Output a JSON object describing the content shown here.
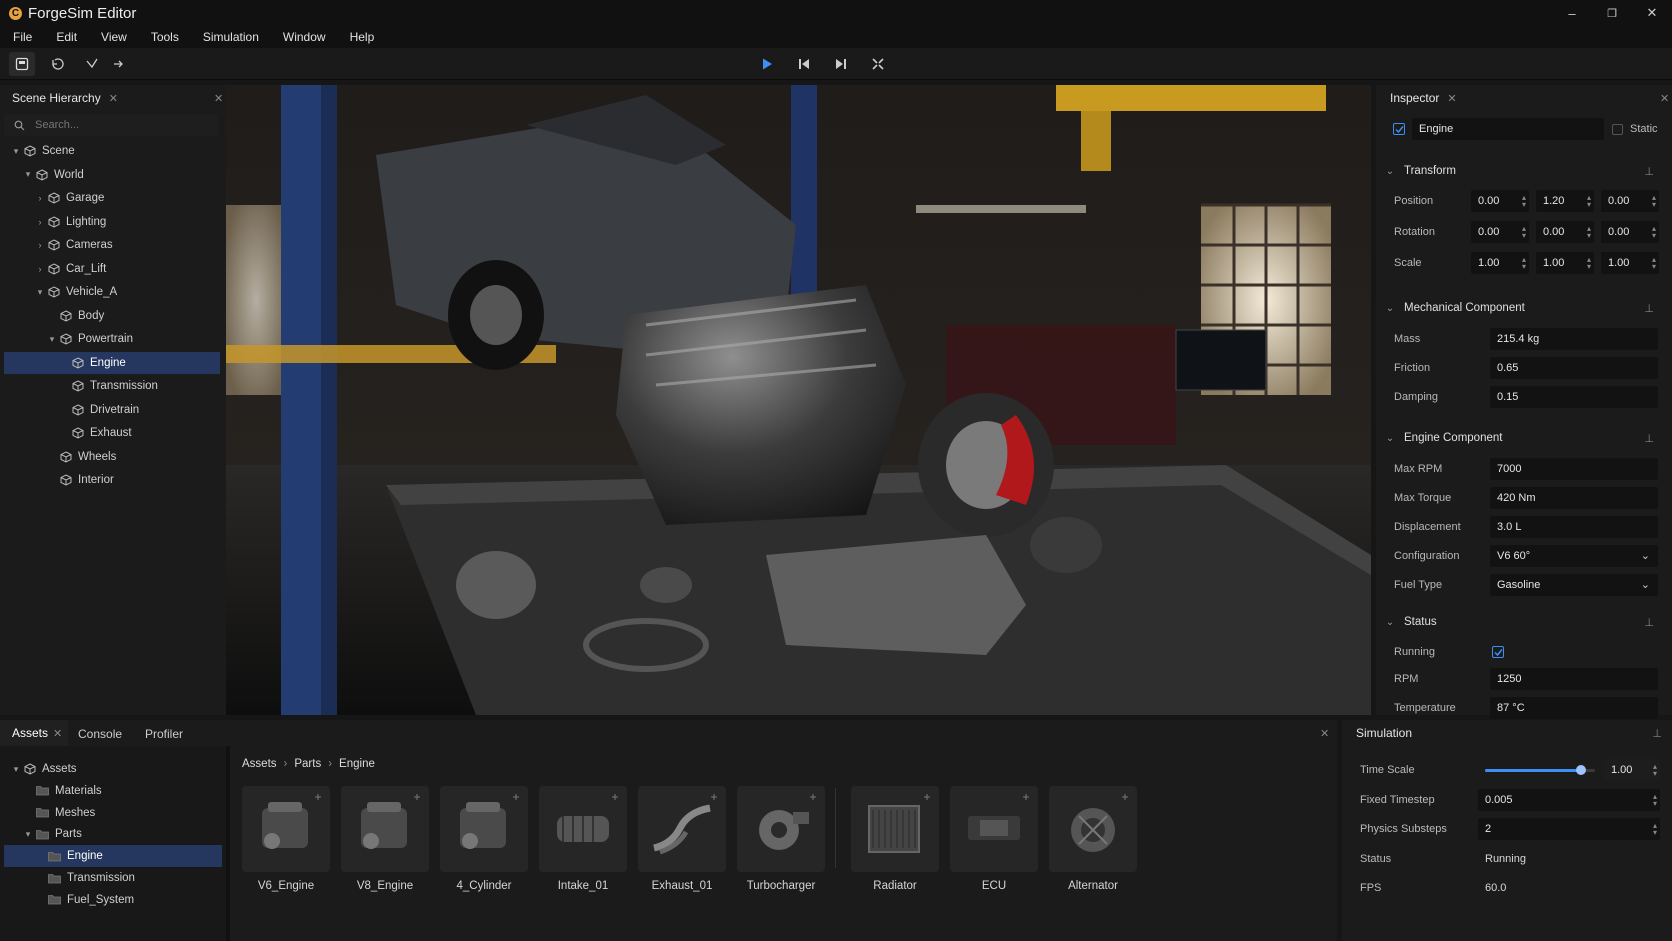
{
  "app": {
    "title": "ForgeSim Editor"
  },
  "window_controls": {
    "minimize": "–",
    "maximize": "❐",
    "close": "✕"
  },
  "menu": [
    "File",
    "Edit",
    "View",
    "Tools",
    "Simulation",
    "Window",
    "Help"
  ],
  "toolbar": {
    "left_tools": [
      "save-icon",
      "undo-icon",
      "select-icon",
      "move-icon"
    ],
    "playback": [
      "play-icon",
      "step-back-icon",
      "step-forward-icon",
      "maximize-icon"
    ],
    "accent": "#3d8ef5"
  },
  "hierarchy": {
    "title": "Scene Hierarchy",
    "search_placeholder": "Search...",
    "items": [
      {
        "label": "Scene",
        "depth": 0,
        "expanded": true
      },
      {
        "label": "World",
        "depth": 1,
        "expanded": true
      },
      {
        "label": "Garage",
        "depth": 2,
        "expanded": false
      },
      {
        "label": "Lighting",
        "depth": 2,
        "expanded": false
      },
      {
        "label": "Cameras",
        "depth": 2,
        "expanded": false
      },
      {
        "label": "Car_Lift",
        "depth": 2,
        "expanded": false
      },
      {
        "label": "Vehicle_A",
        "depth": 2,
        "expanded": true
      },
      {
        "label": "Body",
        "depth": 3
      },
      {
        "label": "Powertrain",
        "depth": 3,
        "expanded": true
      },
      {
        "label": "Engine",
        "depth": 4,
        "selected": true
      },
      {
        "label": "Transmission",
        "depth": 4
      },
      {
        "label": "Drivetrain",
        "depth": 4
      },
      {
        "label": "Exhaust",
        "depth": 4
      },
      {
        "label": "Wheels",
        "depth": 3
      },
      {
        "label": "Interior",
        "depth": 3
      }
    ]
  },
  "viewport": {
    "description_icon": "garage-scene-viewport"
  },
  "inspector": {
    "title": "Inspector",
    "object_name": "Engine",
    "static_label": "Static",
    "transform": {
      "title": "Transform",
      "rows": [
        {
          "label": "Position",
          "values": [
            "0.00",
            "1.20",
            "0.00"
          ]
        },
        {
          "label": "Rotation",
          "values": [
            "0.00",
            "0.00",
            "0.00"
          ]
        },
        {
          "label": "Scale",
          "values": [
            "1.00",
            "1.00",
            "1.00"
          ]
        }
      ]
    },
    "mechanical": {
      "title": "Mechanical Component",
      "rows": [
        {
          "label": "Mass",
          "value": "215.4 kg"
        },
        {
          "label": "Friction",
          "value": "0.65"
        },
        {
          "label": "Damping",
          "value": "0.15"
        }
      ]
    },
    "engine": {
      "title": "Engine Component",
      "rows": [
        {
          "label": "Max RPM",
          "value": "7000"
        },
        {
          "label": "Max Torque",
          "value": "420 Nm"
        },
        {
          "label": "Displacement",
          "value": "3.0 L"
        },
        {
          "label": "Configuration",
          "value": "V6 60°",
          "dropdown": true
        },
        {
          "label": "Fuel Type",
          "value": "Gasoline",
          "dropdown": true
        }
      ]
    },
    "status": {
      "title": "Status",
      "running_label": "Running",
      "running": true,
      "rows": [
        {
          "label": "RPM",
          "value": "1250"
        },
        {
          "label": "Temperature",
          "value": "87 °C"
        }
      ]
    }
  },
  "bottom_tabs": [
    "Assets",
    "Console",
    "Profiler"
  ],
  "asset_tree": [
    {
      "label": "Assets",
      "depth": 0,
      "expanded": true
    },
    {
      "label": "Materials",
      "depth": 1
    },
    {
      "label": "Meshes",
      "depth": 1
    },
    {
      "label": "Parts",
      "depth": 1,
      "expanded": true
    },
    {
      "label": "Engine",
      "depth": 2,
      "selected": true
    },
    {
      "label": "Transmission",
      "depth": 2
    },
    {
      "label": "Fuel_System",
      "depth": 2
    }
  ],
  "breadcrumb": [
    "Assets",
    "Parts",
    "Engine"
  ],
  "assets": [
    "V6_Engine",
    "V8_Engine",
    "4_Cylinder",
    "Intake_01",
    "Exhaust_01",
    "Turbocharger",
    "Radiator",
    "ECU",
    "Alternator"
  ],
  "simulation": {
    "title": "Simulation",
    "time_scale_label": "Time Scale",
    "time_scale": "1.00",
    "time_scale_fraction": 0.87,
    "fixed_timestep_label": "Fixed Timestep",
    "fixed_timestep": "0.005",
    "substeps_label": "Physics Substeps",
    "substeps": "2",
    "status_label": "Status",
    "status": "Running",
    "fps_label": "FPS",
    "fps": "60.0"
  }
}
